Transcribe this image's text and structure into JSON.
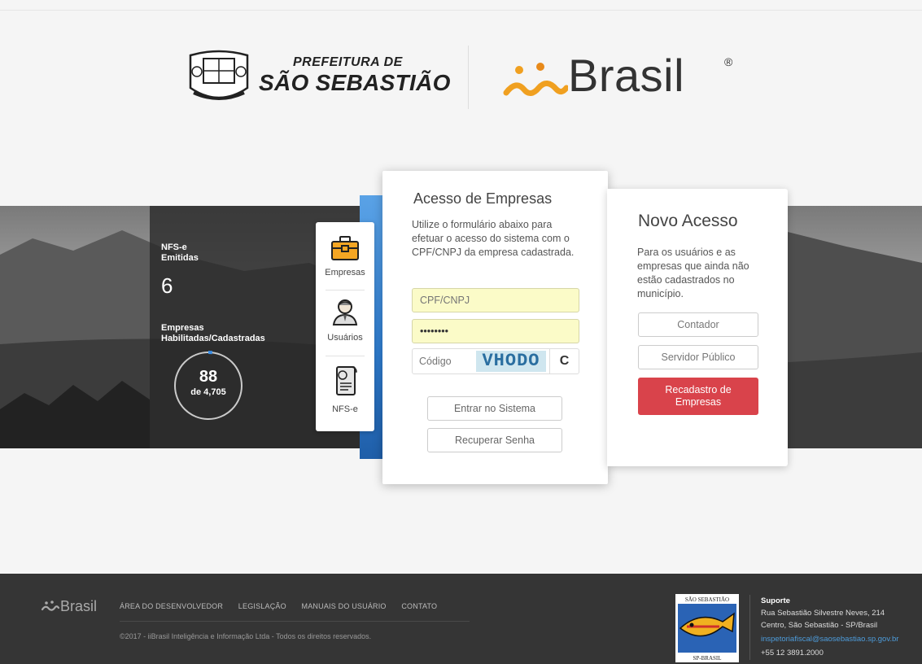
{
  "header": {
    "pref_small": "PREFEITURA DE",
    "pref_big": "SÃO SEBASTIÃO",
    "brasil_logo": "Brasil",
    "brasil_reg": "®"
  },
  "stats": {
    "nfse_label_1": "NFS-e",
    "nfse_label_2": "Emitidas",
    "nfse_value": "6",
    "empresas_label_1": "Empresas",
    "empresas_label_2": "Habilitadas/Cadastradas",
    "empresas_value": "88",
    "empresas_total": "de 4,705",
    "empresas_fraction": 0.0187
  },
  "menu": {
    "items": [
      {
        "label": "Empresas",
        "icon": "briefcase-icon"
      },
      {
        "label": "Usuários",
        "icon": "user-icon"
      },
      {
        "label": "NFS-e",
        "icon": "document-icon"
      }
    ]
  },
  "login": {
    "title": "Acesso de Empresas",
    "description": "Utilize o formulário abaixo para efetuar o acesso do sistema com o CPF/CNPJ da empresa cadastrada.",
    "cpf_placeholder": "CPF/CNPJ",
    "password_value": "••••••••",
    "code_placeholder": "Código",
    "captcha_text": "VHODO",
    "refresh_icon": "C",
    "enter_button": "Entrar no Sistema",
    "recover_button": "Recuperar Senha"
  },
  "novo": {
    "title": "Novo Acesso",
    "description": "Para os usuários e as empresas que ainda não estão cadastrados no município.",
    "contador": "Contador",
    "servidor": "Servidor Público",
    "recadastro_1": "Recadastro de",
    "recadastro_2": "Empresas"
  },
  "footer": {
    "logo": "Brasil",
    "links": [
      "ÁREA DO DESENVOLVEDOR",
      "LEGISLAÇÃO",
      "MANUAIS DO USUÁRIO",
      "CONTATO"
    ],
    "copyright": "©2017 - iiBrasil Inteligência e Informação Ltda - Todos os direitos reservados.",
    "seal_top": "SÃO SEBASTIÃO",
    "seal_bottom": "SP-BRASIL",
    "support_title": "Suporte",
    "address_1": "Rua Sebastião Silvestre Neves, 214",
    "address_2": "Centro, São Sebastião - SP/Brasil",
    "email": "inspetoriafiscal@saosebastiao.sp.gov.br",
    "phone": "+55 12 3891.2000"
  },
  "colors": {
    "accent_blue": "#2f7dd0",
    "danger_red": "#d9434b",
    "field_yellow": "#fbfbc8",
    "footer_bg": "#353535"
  }
}
